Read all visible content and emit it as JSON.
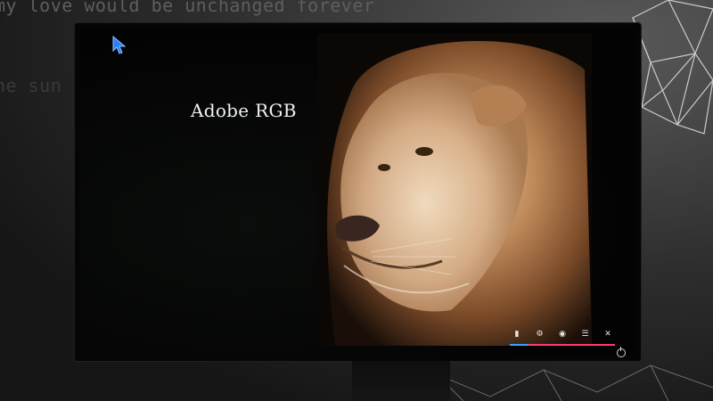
{
  "background": {
    "poster_line_1": "my love would be unchanged forever",
    "poster_line_2": "he sun"
  },
  "screen": {
    "mode_label": "Adobe RGB",
    "photo_subject": "lion"
  },
  "osd_menu": {
    "icons": [
      "input-icon",
      "settings-icon",
      "color-icon",
      "menu-list-icon",
      "close-icon"
    ],
    "accent_blue": "#3aa0ff",
    "accent_red": "#ff3a6e"
  },
  "monitor": {
    "power_icon": "power-icon"
  }
}
